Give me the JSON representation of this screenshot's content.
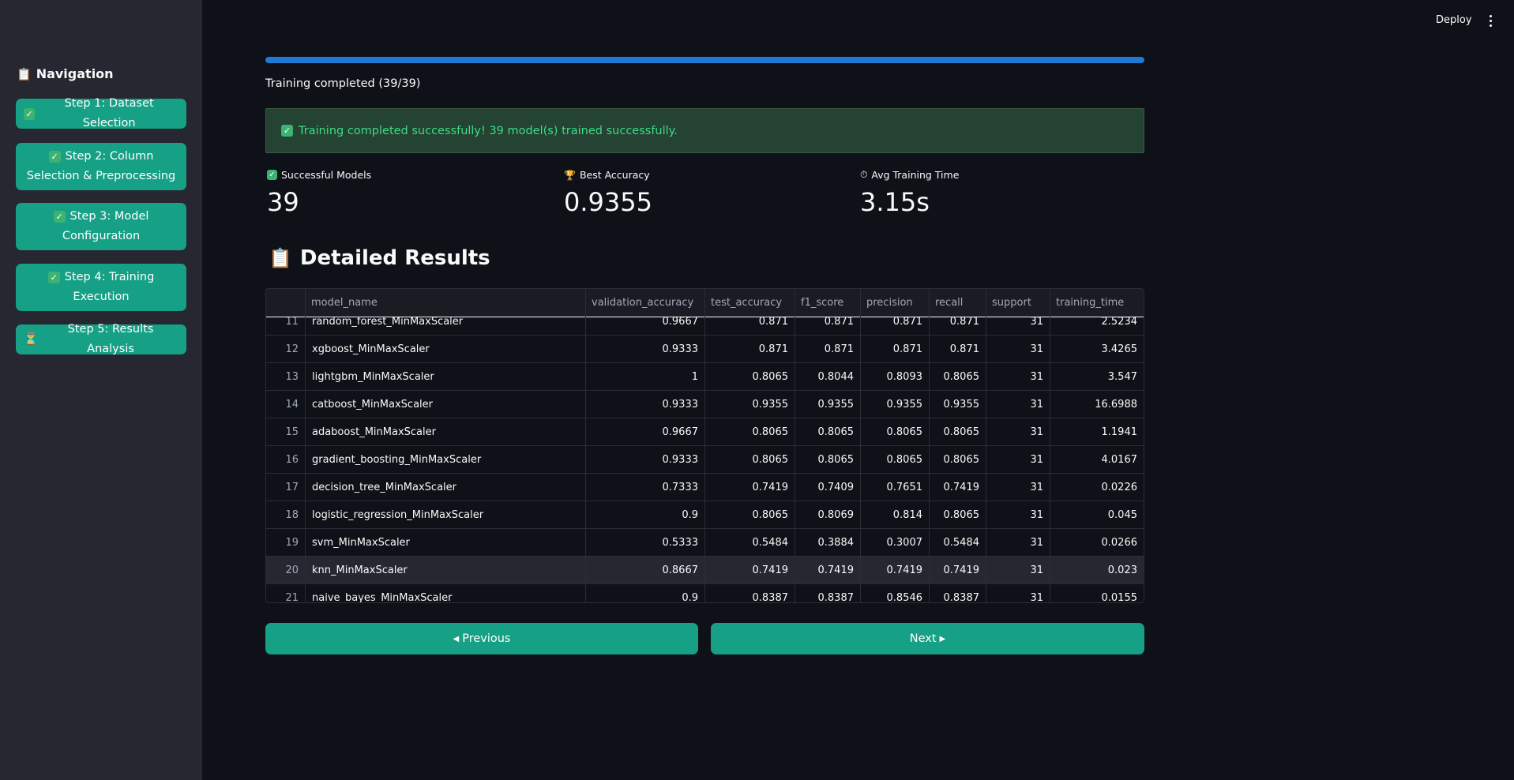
{
  "app": {
    "deploy_label": "Deploy"
  },
  "sidebar": {
    "title": "Navigation",
    "title_icon": "clipboard-icon",
    "items": [
      {
        "label": "Step 1: Dataset Selection",
        "icon": "check-icon"
      },
      {
        "label": "Step 2: Column Selection & Preprocessing",
        "icon": "check-icon"
      },
      {
        "label": "Step 3: Model Configuration",
        "icon": "check-icon"
      },
      {
        "label": "Step 4: Training Execution",
        "icon": "check-icon"
      },
      {
        "label": "Step 5: Results Analysis",
        "icon": "hourglass-icon"
      }
    ]
  },
  "progress": {
    "value": 1.0,
    "text": "Training completed (39/39)"
  },
  "alert": {
    "text": "Training completed successfully! 39 model(s) trained successfully."
  },
  "metrics": [
    {
      "label": "Successful Models",
      "value": "39",
      "icon": "check-icon"
    },
    {
      "label": "Best Accuracy",
      "value": "0.9355",
      "icon": "trophy-icon"
    },
    {
      "label": "Avg Training Time",
      "value": "3.15s",
      "icon": "stopwatch-icon"
    }
  ],
  "results": {
    "title": "Detailed Results",
    "title_icon": "clipboard-icon",
    "columns": [
      "",
      "model_name",
      "validation_accuracy",
      "test_accuracy",
      "f1_score",
      "precision",
      "recall",
      "support",
      "training_time"
    ],
    "rows": [
      [
        "11",
        "random_forest_MinMaxScaler",
        "0.9667",
        "0.871",
        "0.871",
        "0.871",
        "0.871",
        "31",
        "2.5234"
      ],
      [
        "12",
        "xgboost_MinMaxScaler",
        "0.9333",
        "0.871",
        "0.871",
        "0.871",
        "0.871",
        "31",
        "3.4265"
      ],
      [
        "13",
        "lightgbm_MinMaxScaler",
        "1",
        "0.8065",
        "0.8044",
        "0.8093",
        "0.8065",
        "31",
        "3.547"
      ],
      [
        "14",
        "catboost_MinMaxScaler",
        "0.9333",
        "0.9355",
        "0.9355",
        "0.9355",
        "0.9355",
        "31",
        "16.6988"
      ],
      [
        "15",
        "adaboost_MinMaxScaler",
        "0.9667",
        "0.8065",
        "0.8065",
        "0.8065",
        "0.8065",
        "31",
        "1.1941"
      ],
      [
        "16",
        "gradient_boosting_MinMaxScaler",
        "0.9333",
        "0.8065",
        "0.8065",
        "0.8065",
        "0.8065",
        "31",
        "4.0167"
      ],
      [
        "17",
        "decision_tree_MinMaxScaler",
        "0.7333",
        "0.7419",
        "0.7409",
        "0.7651",
        "0.7419",
        "31",
        "0.0226"
      ],
      [
        "18",
        "logistic_regression_MinMaxScaler",
        "0.9",
        "0.8065",
        "0.8069",
        "0.814",
        "0.8065",
        "31",
        "0.045"
      ],
      [
        "19",
        "svm_MinMaxScaler",
        "0.5333",
        "0.5484",
        "0.3884",
        "0.3007",
        "0.5484",
        "31",
        "0.0266"
      ],
      [
        "20",
        "knn_MinMaxScaler",
        "0.8667",
        "0.7419",
        "0.7419",
        "0.7419",
        "0.7419",
        "31",
        "0.023"
      ],
      [
        "21",
        "naive_bayes_MinMaxScaler",
        "0.9",
        "0.8387",
        "0.8387",
        "0.8546",
        "0.8387",
        "31",
        "0.0155"
      ]
    ]
  },
  "footer": {
    "previous_label": "Previous",
    "next_label": "Next"
  },
  "colors": {
    "background": "#0e1117",
    "sidebar": "#262730",
    "accent": "#16a085",
    "progress": "#1f7ad6",
    "success_text": "#3ddc84"
  }
}
